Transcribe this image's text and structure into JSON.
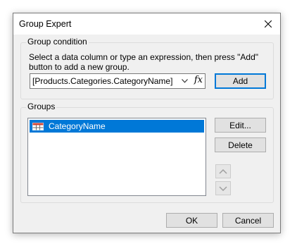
{
  "window": {
    "title": "Group Expert",
    "close_icon": "close-icon"
  },
  "group_condition": {
    "label": "Group condition",
    "description": "Select a data column or type an expression, then press \"Add\" button to add a new group.",
    "expression_value": "[Products.Categories.CategoryName]",
    "expression_button_label": "fx",
    "add_label": "Add"
  },
  "groups": {
    "label": "Groups",
    "items": [
      {
        "label": "CategoryName",
        "icon": "table-icon",
        "selected": true
      }
    ],
    "edit_label": "Edit...",
    "delete_label": "Delete",
    "move_up_icon": "chevron-up-icon",
    "move_down_icon": "chevron-down-icon"
  },
  "footer": {
    "ok_label": "OK",
    "cancel_label": "Cancel"
  },
  "colors": {
    "selection": "#0078d7",
    "dialog_bg": "#f0f0f0",
    "default_button_border": "#0078d7"
  }
}
